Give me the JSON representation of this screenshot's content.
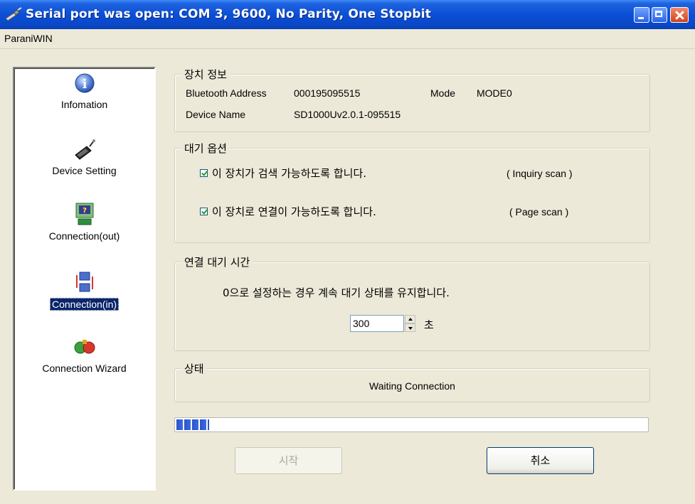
{
  "window": {
    "title": "Serial port was open: COM 3, 9600, No Parity, One Stopbit"
  },
  "menu": {
    "items": [
      "ParaniWIN"
    ]
  },
  "sidebar": {
    "items": [
      {
        "label": "Infomation",
        "icon": "info-icon"
      },
      {
        "label": "Device Setting",
        "icon": "device-icon"
      },
      {
        "label": "Connection(out)",
        "icon": "connection-out-icon"
      },
      {
        "label": "Connection(in)",
        "icon": "connection-in-icon",
        "selected": true
      },
      {
        "label": "Connection Wizard",
        "icon": "wizard-icon"
      }
    ]
  },
  "device_info": {
    "title": "장치 정보",
    "bt_label": "Bluetooth Address",
    "bt_value": "000195095515",
    "mode_label": "Mode",
    "mode_value": "MODE0",
    "name_label": "Device Name",
    "name_value": "SD1000Uv2.0.1-095515"
  },
  "wait_options": {
    "title": "대기 옵션",
    "inquiry_label": "이 장치가 검색 가능하도록 합니다.",
    "inquiry_hint": "( Inquiry scan )",
    "inquiry_checked": true,
    "page_label": "이 장치로 연결이 가능하도록 합니다.",
    "page_hint": "( Page scan )",
    "page_checked": true
  },
  "timeout": {
    "title": "연결 대기 시간",
    "description": "0으로 설정하는 경우 계속 대기 상태를 유지합니다.",
    "value": "300",
    "unit": "초"
  },
  "status": {
    "title": "상태",
    "text": "Waiting Connection"
  },
  "progress": {
    "fraction": 0.07
  },
  "buttons": {
    "start": "시작",
    "cancel": "취소"
  },
  "colors": {
    "titlebar": "#0b4fd6",
    "selection": "#0a246a",
    "progress": "#2b55c7"
  }
}
